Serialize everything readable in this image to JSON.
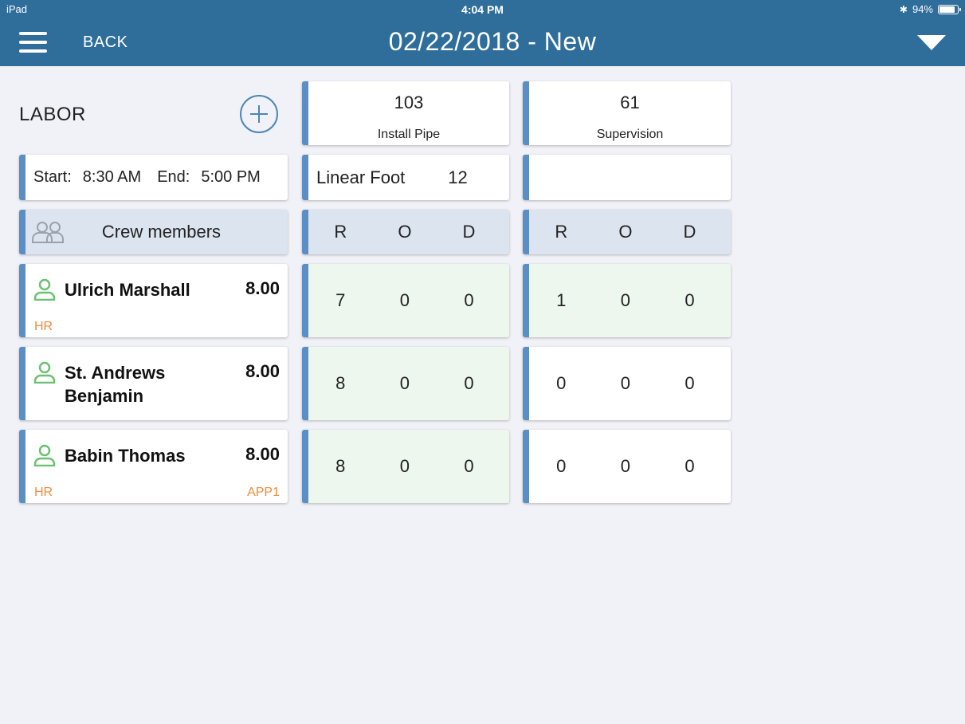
{
  "status_bar": {
    "device": "iPad",
    "time": "4:04 PM",
    "battery": "94%"
  },
  "header": {
    "back_label": "BACK",
    "title": "02/22/2018 - New"
  },
  "labor": {
    "title": "LABOR",
    "start_label": "Start:",
    "start_time": "8:30 AM",
    "end_label": "End:",
    "end_time": "5:00 PM",
    "crew_label": "Crew members"
  },
  "members": [
    {
      "name": "Ulrich Marshall",
      "hours": "8.00",
      "class_left": "HR",
      "class_right": ""
    },
    {
      "name": "St. Andrews Benjamin",
      "hours": "8.00",
      "class_left": "",
      "class_right": ""
    },
    {
      "name": "Babin Thomas",
      "hours": "8.00",
      "class_left": "HR",
      "class_right": "APP1"
    }
  ],
  "tasks": [
    {
      "code": "103",
      "name": "Install Pipe",
      "unit": "Linear Foot",
      "quantity": "12",
      "headers": [
        "R",
        "O",
        "D"
      ],
      "rows": [
        [
          "7",
          "0",
          "0"
        ],
        [
          "8",
          "0",
          "0"
        ],
        [
          "8",
          "0",
          "0"
        ]
      ]
    },
    {
      "code": "61",
      "name": "Supervision",
      "unit": "",
      "quantity": "",
      "headers": [
        "R",
        "O",
        "D"
      ],
      "rows": [
        [
          "1",
          "0",
          "0"
        ],
        [
          "0",
          "0",
          "0"
        ],
        [
          "0",
          "0",
          "0"
        ]
      ]
    }
  ],
  "colors": {
    "header_bg": "#2f6e9b",
    "accent": "#5b8ec4",
    "person_icon": "#6cc070",
    "class_text": "#f28c3c",
    "filled_cell": "#eef7ee"
  }
}
